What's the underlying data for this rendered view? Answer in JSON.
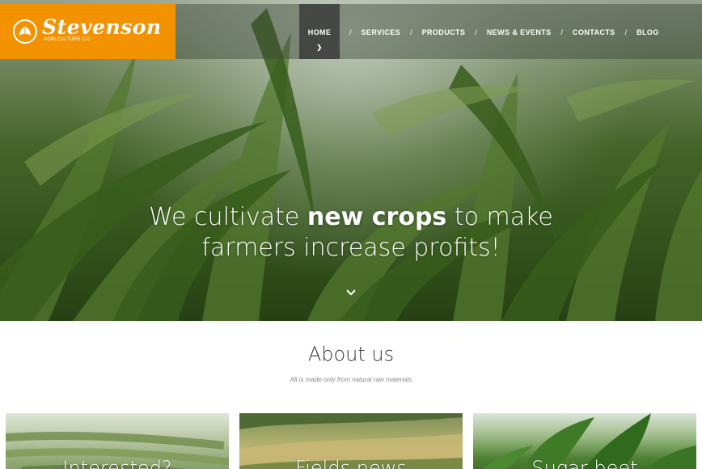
{
  "header": {
    "brand_name": "Stevenson",
    "brand_sub": "AGRICULTURE CO.",
    "nav": [
      {
        "label": "HOME",
        "active": true
      },
      {
        "label": "SERVICES"
      },
      {
        "label": "PRODUCTS"
      },
      {
        "label": "NEWS & EVENTS"
      },
      {
        "label": "CONTACTS"
      },
      {
        "label": "BLOG"
      }
    ],
    "separator": "/"
  },
  "hero": {
    "headline_part1": "We cultivate ",
    "headline_bold": "new crops",
    "headline_part2": " to make",
    "headline_line2": "farmers increase profits!"
  },
  "about": {
    "title": "About us",
    "subtitle": "All is made only from natural raw materials"
  },
  "cards": [
    {
      "title": "Interested?"
    },
    {
      "title": "Fields news"
    },
    {
      "title": "Sugar beet"
    }
  ],
  "colors": {
    "brand_orange": "#f39200",
    "active_nav_bg": "#323232"
  }
}
